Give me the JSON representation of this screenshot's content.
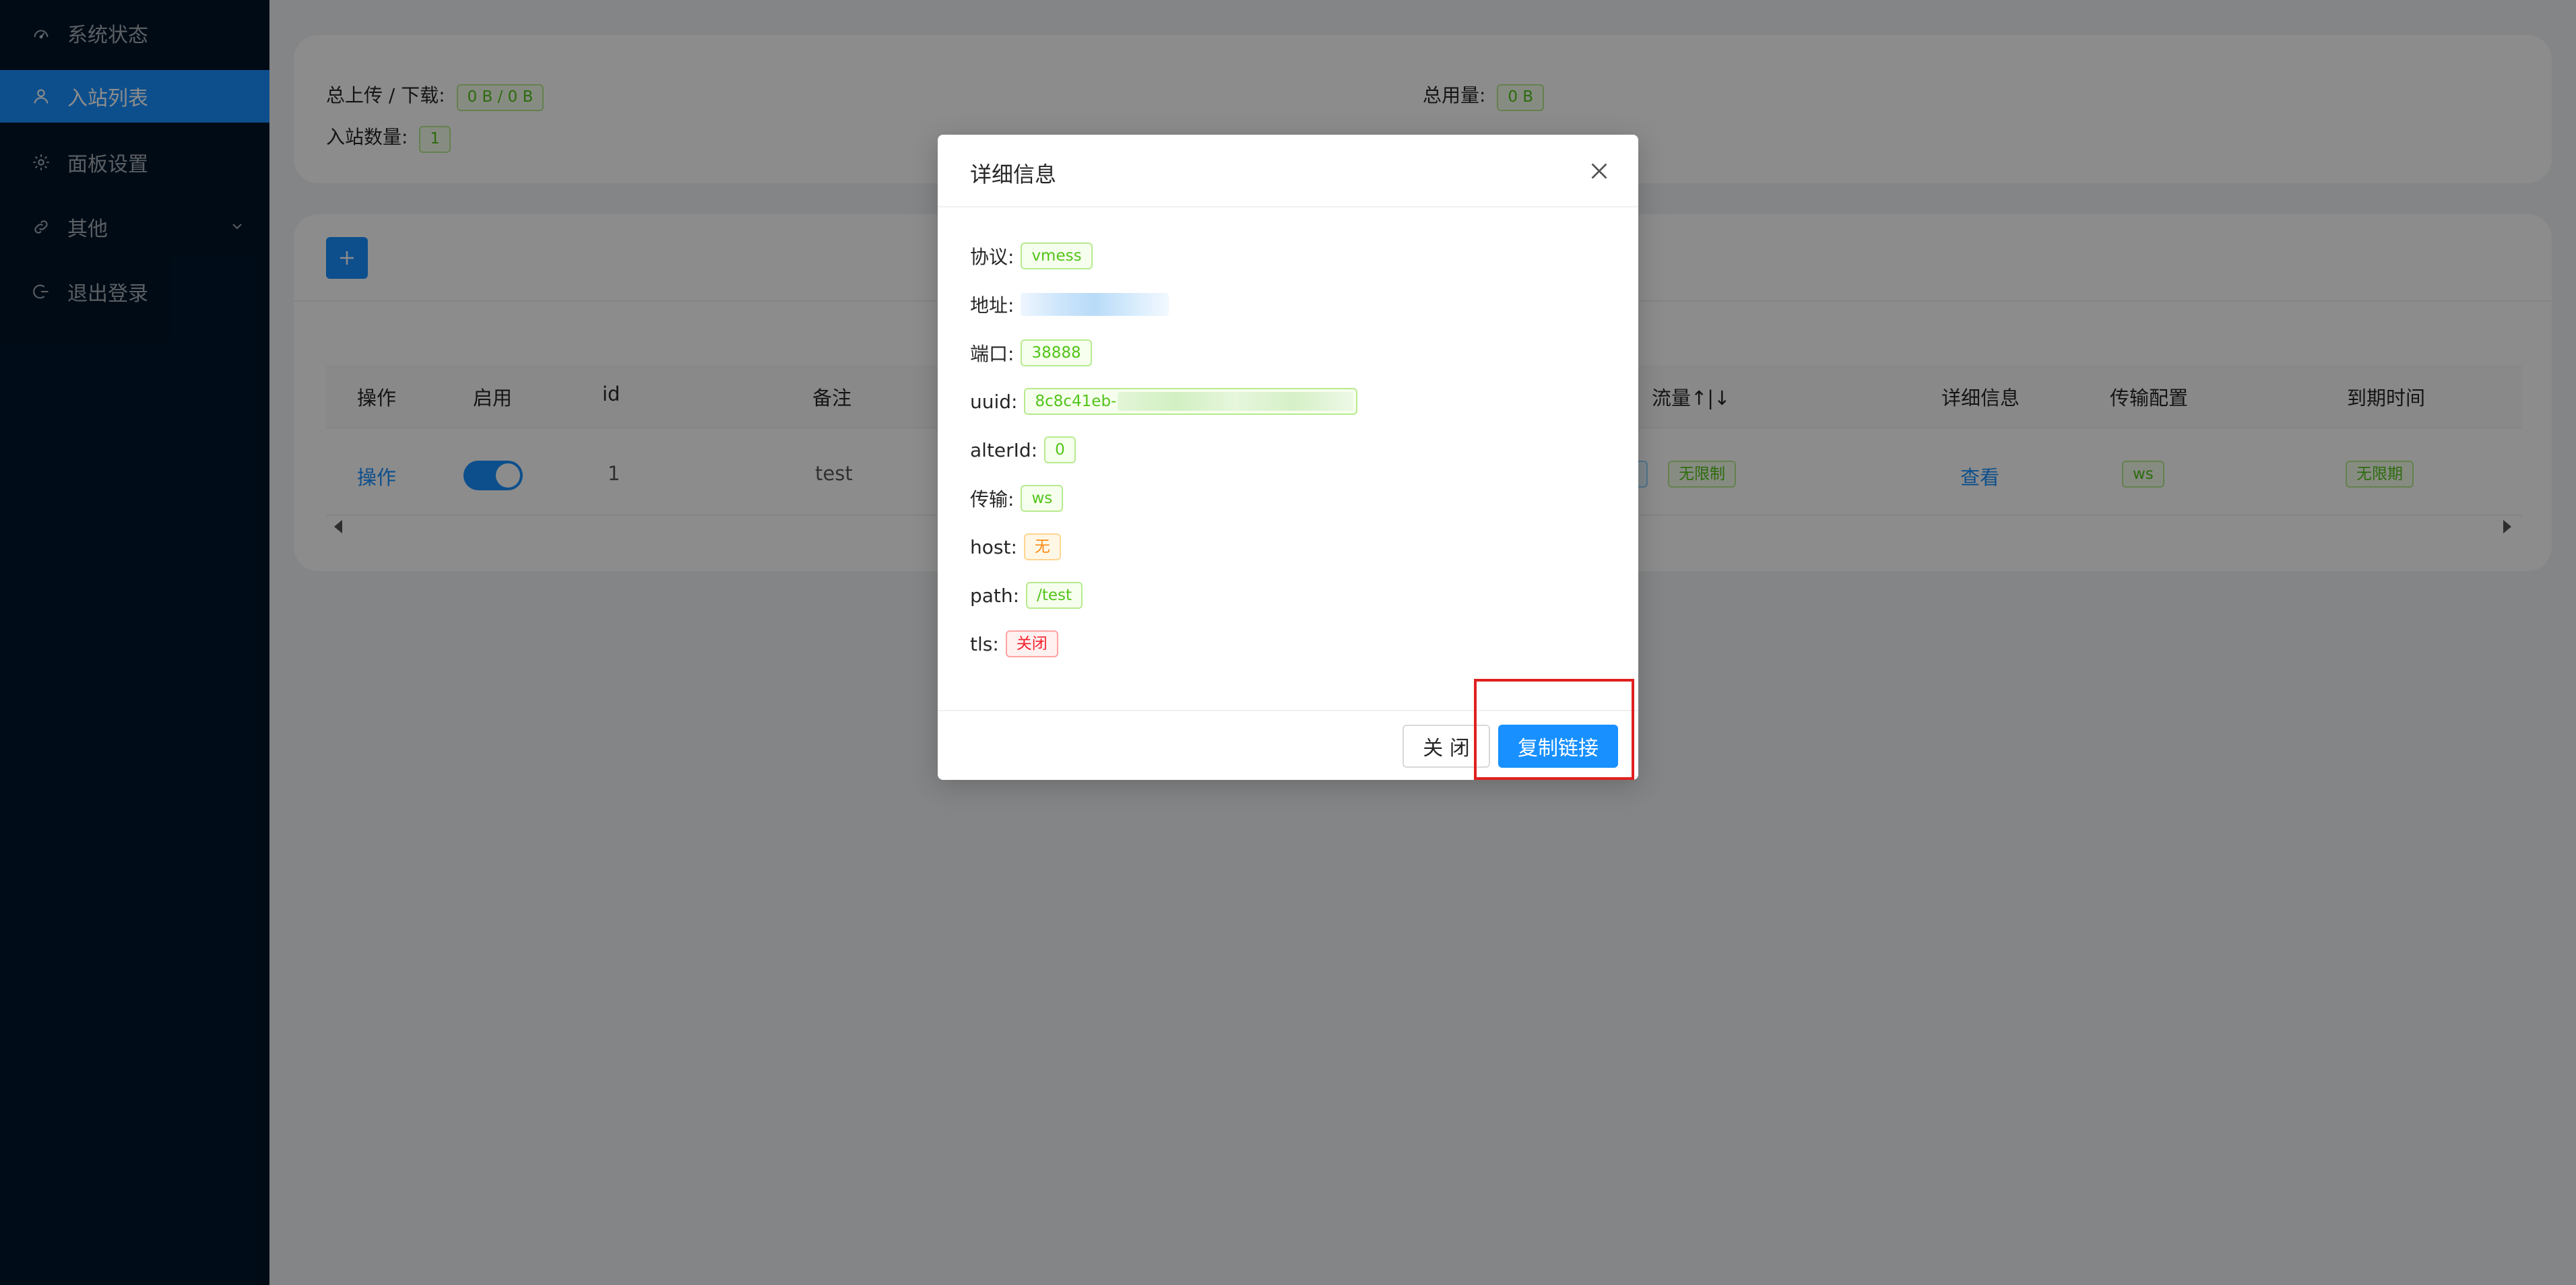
{
  "sidebar": {
    "items": [
      {
        "label": "系统状态",
        "icon": "dashboard-icon"
      },
      {
        "label": "入站列表",
        "icon": "user-icon",
        "active": true
      },
      {
        "label": "面板设置",
        "icon": "gear-icon"
      },
      {
        "label": "其他",
        "icon": "link-icon",
        "has_submenu": true
      },
      {
        "label": "退出登录",
        "icon": "logout-icon"
      }
    ]
  },
  "stats": {
    "upload_download_label": "总上传 / 下载:",
    "upload_download_value": "0 B / 0 B",
    "total_usage_label": "总用量:",
    "total_usage_value": "0 B",
    "inbound_count_label": "入站数量:",
    "inbound_count_value": "1"
  },
  "table": {
    "headers": {
      "action": "操作",
      "enable": "启用",
      "id": "id",
      "remark": "备注",
      "traffic": "流量↑|↓",
      "details": "详细信息",
      "transport": "传输配置",
      "expiry": "到期时间"
    },
    "row": {
      "action": "操作",
      "id": "1",
      "remark": "test",
      "traffic": "无限制",
      "details": "查看",
      "transport": "ws",
      "expiry": "无限期"
    }
  },
  "modal": {
    "title": "详细信息",
    "fields": {
      "protocol_label": "协议:",
      "protocol_value": "vmess",
      "address_label": "地址:",
      "port_label": "端口:",
      "port_value": "38888",
      "uuid_label": "uuid:",
      "uuid_value": "8c8c41eb-",
      "alterid_label": "alterId:",
      "alterid_value": "0",
      "network_label": "传输:",
      "network_value": "ws",
      "host_label": "host:",
      "host_value": "无",
      "path_label": "path:",
      "path_value": "/test",
      "tls_label": "tls:",
      "tls_value": "关闭"
    },
    "close_label": "关 闭",
    "copy_label": "复制链接"
  },
  "colors": {
    "sidebar_bg": "#001529",
    "primary": "#1890ff",
    "highlight": "#e02020"
  }
}
